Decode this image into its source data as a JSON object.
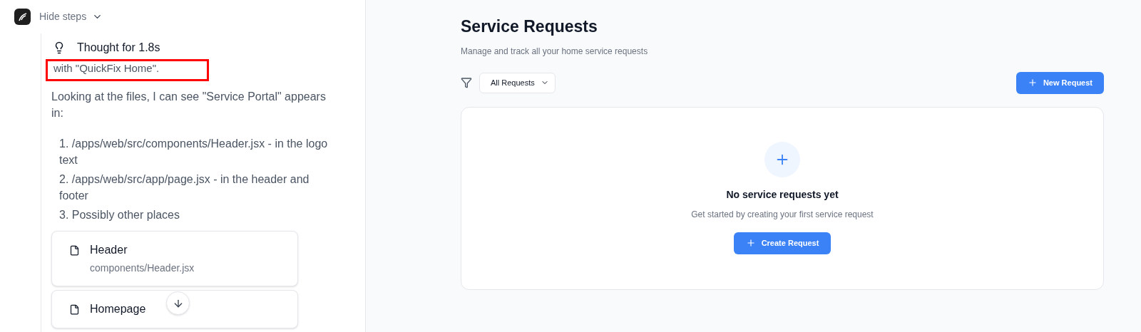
{
  "chat_panel": {
    "steps_toggle": {
      "label": "Hide steps",
      "expanded": true
    },
    "thought": {
      "label": "Thought for 1.8s"
    },
    "highlighted_text": "with \"QuickFix Home\".",
    "paragraph": "Looking at the files, I can see \"Service Portal\" appears in:",
    "list": [
      {
        "marker": "1.",
        "text": "/apps/web/src/components/Header.jsx - in the logo text"
      },
      {
        "marker": "2.",
        "text": "/apps/web/src/app/page.jsx - in the header and footer"
      },
      {
        "marker": "3.",
        "text": "Possibly other places"
      }
    ],
    "file_cards": [
      {
        "title": "Header",
        "path": "components/Header.jsx"
      },
      {
        "title": "Homepage"
      }
    ]
  },
  "main": {
    "title": "Service Requests",
    "subtitle": "Manage and track all your home service requests",
    "filter": {
      "value": "All Requests"
    },
    "new_button": "New Request",
    "empty_state": {
      "title": "No service requests yet",
      "description": "Get started by creating your first service request",
      "button": "Create Request"
    }
  }
}
